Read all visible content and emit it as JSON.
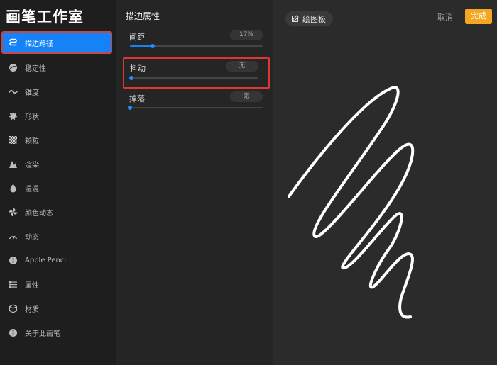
{
  "app": {
    "title": "画笔工作室"
  },
  "sidebar": {
    "items": [
      {
        "label": "描边路径",
        "icon": "stroke-path-icon",
        "active": true
      },
      {
        "label": "稳定性",
        "icon": "stabilization-icon"
      },
      {
        "label": "锥度",
        "icon": "taper-icon"
      },
      {
        "label": "形状",
        "icon": "shape-icon"
      },
      {
        "label": "颗粒",
        "icon": "grain-icon"
      },
      {
        "label": "渲染",
        "icon": "rendering-icon"
      },
      {
        "label": "湿混",
        "icon": "wet-mix-icon"
      },
      {
        "label": "颜色动态",
        "icon": "color-dynamics-icon"
      },
      {
        "label": "动态",
        "icon": "dynamics-icon"
      },
      {
        "label": "Apple Pencil",
        "icon": "apple-pencil-icon"
      },
      {
        "label": "属性",
        "icon": "properties-icon"
      },
      {
        "label": "材质",
        "icon": "material-icon"
      },
      {
        "label": "关于此画笔",
        "icon": "about-icon"
      }
    ]
  },
  "panel": {
    "title": "描边属性",
    "settings": [
      {
        "label": "间距",
        "value": "17%",
        "level": 0.17
      },
      {
        "label": "抖动",
        "value": "无",
        "level": 0
      },
      {
        "label": "掉落",
        "value": "无",
        "level": 0
      }
    ]
  },
  "canvas": {
    "pad_label": "绘图板",
    "cancel_label": "取消",
    "done_label": "完成"
  },
  "colors": {
    "accent": "#1682f7",
    "done": "#f5a623",
    "highlight": "#d93a2f"
  }
}
